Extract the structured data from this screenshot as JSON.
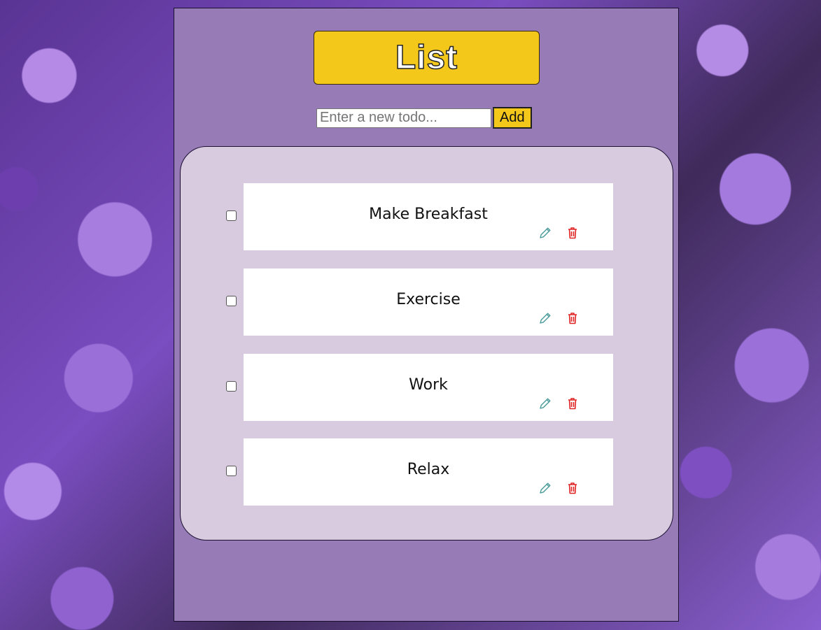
{
  "header": {
    "title": "List"
  },
  "new_todo": {
    "placeholder": "Enter a new todo...",
    "value": "",
    "add_label": "Add"
  },
  "todos": [
    {
      "text": "Make Breakfast",
      "done": false
    },
    {
      "text": "Exercise",
      "done": false
    },
    {
      "text": "Work",
      "done": false
    },
    {
      "text": "Relax",
      "done": false
    }
  ],
  "icons": {
    "edit": "pencil-icon",
    "delete": "trash-icon"
  },
  "colors": {
    "panel": "#967bb6",
    "accent": "#f3c81a",
    "list_bg": "#d8cadf",
    "edit_icon": "#4a9a9a",
    "delete_icon": "#e02424"
  }
}
